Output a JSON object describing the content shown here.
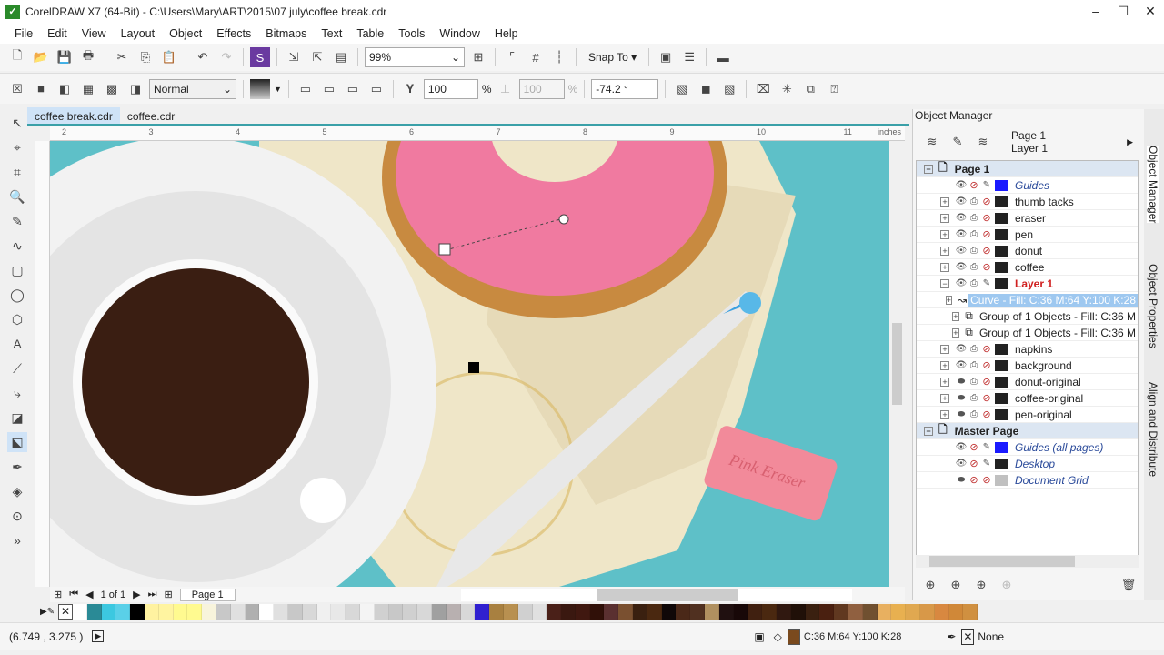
{
  "window": {
    "title": "CorelDRAW X7 (64-Bit) - C:\\Users\\Mary\\ART\\2015\\07 july\\coffee break.cdr"
  },
  "menu": [
    "File",
    "Edit",
    "View",
    "Layout",
    "Object",
    "Effects",
    "Bitmaps",
    "Text",
    "Table",
    "Tools",
    "Window",
    "Help"
  ],
  "toolbar": {
    "zoom": "99%",
    "snap_to": "Snap To"
  },
  "propbar": {
    "blend_mode": "Normal",
    "transparency": "100",
    "transparency2": "100",
    "percent": "%",
    "angle": "-74.2 °"
  },
  "tabs": [
    "coffee break.cdr",
    "coffee.cdr"
  ],
  "ruler": {
    "ticks": [
      "2",
      "3",
      "4",
      "5",
      "6",
      "7",
      "8",
      "9",
      "10",
      "11"
    ],
    "unit": "inches"
  },
  "pagenav": {
    "counter": "1 of 1",
    "page_tab": "Page 1"
  },
  "canvas": {
    "eraser_text": "Pink Eraser"
  },
  "docker": {
    "title": "Object Manager",
    "current_page": "Page 1",
    "current_layer": "Layer 1",
    "tree": [
      {
        "type": "page",
        "label": "Page 1"
      },
      {
        "type": "layer",
        "label": "Guides",
        "color": "#1a1aff",
        "italic": true,
        "exp": false
      },
      {
        "type": "layer",
        "label": "thumb tacks",
        "color": "#222222"
      },
      {
        "type": "layer",
        "label": "eraser",
        "color": "#222222"
      },
      {
        "type": "layer",
        "label": "pen",
        "color": "#222222"
      },
      {
        "type": "layer",
        "label": "donut",
        "color": "#222222"
      },
      {
        "type": "layer",
        "label": "coffee",
        "color": "#222222"
      },
      {
        "type": "active",
        "label": "Layer 1",
        "color": "#222222"
      },
      {
        "type": "obj",
        "label": "Curve - Fill: C:36 M:64 Y:100 K:28",
        "selected": true
      },
      {
        "type": "obj",
        "label": "Group of 1 Objects - Fill: C:36 M"
      },
      {
        "type": "obj",
        "label": "Group of 1 Objects - Fill: C:36 M"
      },
      {
        "type": "layer",
        "label": "napkins",
        "color": "#222222"
      },
      {
        "type": "layer",
        "label": "background",
        "color": "#222222"
      },
      {
        "type": "layer",
        "label": "donut-original",
        "color": "#222222",
        "hidden": true
      },
      {
        "type": "layer",
        "label": "coffee-original",
        "color": "#222222",
        "hidden": true
      },
      {
        "type": "layer",
        "label": "pen-original",
        "color": "#222222",
        "hidden": true
      },
      {
        "type": "page",
        "label": "Master Page"
      },
      {
        "type": "master",
        "label": "Guides (all pages)",
        "color": "#1a1aff"
      },
      {
        "type": "master",
        "label": "Desktop",
        "color": "#222222"
      },
      {
        "type": "master",
        "label": "Document Grid",
        "color": "#c0c0c0",
        "hidden": true
      }
    ]
  },
  "vertical_tabs": [
    "Object Manager",
    "Object Properties",
    "Align and Distribute"
  ],
  "palette": [
    "#ffffff",
    "#2a8a96",
    "#3cc8e0",
    "#5ad0e8",
    "#000000",
    "#fff2a0",
    "#fff4a0",
    "#fffa90",
    "#fffa90",
    "#f8f4dc",
    "#c8c8c8",
    "#e0e0e0",
    "#b0b0b0",
    "#ffffff",
    "#e0e0e0",
    "#c8c8c8",
    "#d8d8d8",
    "#f0f0f0",
    "#e8e8e8",
    "#d8d8d8",
    "#f4f4f4",
    "#d0d0d0",
    "#c8c8c8",
    "#d0d0d0",
    "#d8d8d8",
    "#a0a0a0",
    "#b8b0b0",
    "#d8d8d8",
    "#3020d0",
    "#a88040",
    "#b89050",
    "#d0d0d0",
    "#e0e0e0",
    "#4a2018",
    "#3a1810",
    "#401810",
    "#301008",
    "#5a3030",
    "#7a5030",
    "#3a2010",
    "#4a2810",
    "#100808",
    "#4a2818",
    "#503020",
    "#b09060",
    "#201010",
    "#180808",
    "#402010",
    "#4a2810",
    "#301810",
    "#201008",
    "#3a2010",
    "#4a2010",
    "#603820",
    "#906040",
    "#705030",
    "#e8b060",
    "#e8b050",
    "#e0a850",
    "#d89848",
    "#d88840",
    "#d08838",
    "#d09040"
  ],
  "status": {
    "coords": "(6.749 , 3.275 )",
    "fill": "C:36 M:64 Y:100 K:28",
    "fill_color": "#7a4a1e",
    "outline": "None"
  }
}
